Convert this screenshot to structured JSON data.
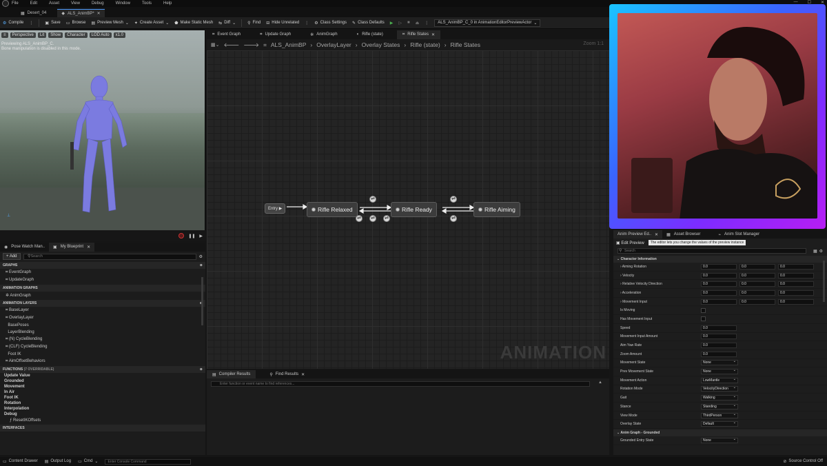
{
  "menubar": {
    "items": [
      "File",
      "Edit",
      "Asset",
      "View",
      "Debug",
      "Window",
      "Tools",
      "Help"
    ]
  },
  "tabs": [
    {
      "label": "Desert_04"
    },
    {
      "label": "ALS_AnimBP*"
    }
  ],
  "toolbar": {
    "compile": "Compile",
    "save": "Save",
    "browse": "Browse",
    "preview_mesh": "Preview Mesh",
    "create_asset": "Create Asset",
    "make_static_mesh": "Make Static Mesh",
    "diff": "Diff",
    "find": "Find",
    "hide_unrelated": "Hide Unrelated",
    "class_settings": "Class Settings",
    "class_defaults": "Class Defaults",
    "preview_actor": "ALS_AnimBP_C_0 in AnimationEditorPreviewActor"
  },
  "viewport": {
    "buttons": [
      "Perspective",
      "Lit",
      "Show",
      "Character",
      "LOD Auto",
      "x1.0"
    ],
    "info_line1": "Previewing ALS_AnimBP_C.",
    "info_line2": "Bone manipulation is disabled in this mode."
  },
  "left_tabs": [
    "Pose Watch Man..",
    "My Blueprint"
  ],
  "my_blueprint": {
    "add": "+ Add",
    "search_placeholder": "Search",
    "sections": {
      "graphs": "GRAPHS",
      "anim_graphs": "ANIMATION GRAPHS",
      "anim_layers": "ANIMATION LAYERS",
      "functions": "FUNCTIONS",
      "functions_count": "(7 OVERRIDABLE)",
      "interfaces": "INTERFACES"
    },
    "graphs": [
      "EventGraph",
      "UpdateGraph"
    ],
    "anim_graphs": [
      "AnimGraph"
    ],
    "anim_layers": [
      "BaseLayer",
      "OverlayLayer",
      "BasePoses",
      "LayerBlending",
      "(N) CycleBlending",
      "(CLF) CycleBlending",
      "Foot IK",
      "AimOffsetBehaviors"
    ],
    "functions": [
      "Update Value",
      "Grounded",
      "Movement",
      "In Air",
      "Foot IK",
      "Rotation",
      "Interpolation",
      "Debug",
      "ResetIKOffsets"
    ]
  },
  "graph_tabs": [
    "Event Graph",
    "Update Graph",
    "AnimGraph",
    "Rifle (state)",
    "Rifle States"
  ],
  "breadcrumb": {
    "items": [
      "ALS_AnimBP",
      "OverlayLayer",
      "Overlay States",
      "Rifle (state)",
      "Rifle States"
    ],
    "zoom": "Zoom 1:1"
  },
  "graph": {
    "entry": "Entry",
    "states": [
      "Rifle Relaxed",
      "Rifle Ready",
      "Rifle Aiming"
    ],
    "watermark": "ANIMATION"
  },
  "bottom_tabs": [
    "Compiler Results",
    "Find Results"
  ],
  "results": {
    "search_placeholder": "Enter function or event name to find references..."
  },
  "right_tabs": [
    "Anim Preview Ed..",
    "Asset Browser",
    "Anim Slot Manager"
  ],
  "right_panel": {
    "edit_preview": "Edit Preview",
    "tooltip": "The editor lets you change the values of the preview instance",
    "search_placeholder": "Search",
    "section1": "Character Information",
    "section2": "Anim Graph - Grounded",
    "vec_rows": [
      {
        "label": "Aiming Rotation",
        "values": [
          "0.0",
          "0.0",
          "0.0"
        ]
      },
      {
        "label": "Velocity",
        "values": [
          "0.0",
          "0.0",
          "0.0"
        ]
      },
      {
        "label": "Relative Velocity Direction",
        "values": [
          "0.0",
          "0.0",
          "0.0"
        ]
      },
      {
        "label": "Acceleration",
        "values": [
          "0.0",
          "0.0",
          "0.0"
        ]
      },
      {
        "label": "Movement Input",
        "values": [
          "0.0",
          "0.0",
          "0.0"
        ]
      }
    ],
    "check_rows": [
      "Is Moving",
      "Has Movement Input"
    ],
    "float_rows": [
      {
        "label": "Speed",
        "value": "0.0"
      },
      {
        "label": "Movement Input Amount",
        "value": "0.0"
      },
      {
        "label": "Aim Yaw Rate",
        "value": "0.0"
      },
      {
        "label": "Zoom Amount",
        "value": "0.0"
      }
    ],
    "enum_rows": [
      {
        "label": "Movement State",
        "value": "None"
      },
      {
        "label": "Prev Movement State",
        "value": "None"
      },
      {
        "label": "Movement Action",
        "value": "LowMantle"
      },
      {
        "label": "Rotation Mode",
        "value": "VelocityDirection"
      },
      {
        "label": "Gait",
        "value": "Walking"
      },
      {
        "label": "Stance",
        "value": "Standing"
      },
      {
        "label": "View Mode",
        "value": "ThirdPerson"
      },
      {
        "label": "Overlay State",
        "value": "Default"
      }
    ],
    "grounded_rows": [
      {
        "label": "Grounded Entry State",
        "value": "None"
      }
    ]
  },
  "statusbar": {
    "content_drawer": "Content Drawer",
    "output_log": "Output Log",
    "cmd": "Cmd",
    "console_placeholder": "Enter Console Command",
    "source_control": "Source Control Off"
  }
}
